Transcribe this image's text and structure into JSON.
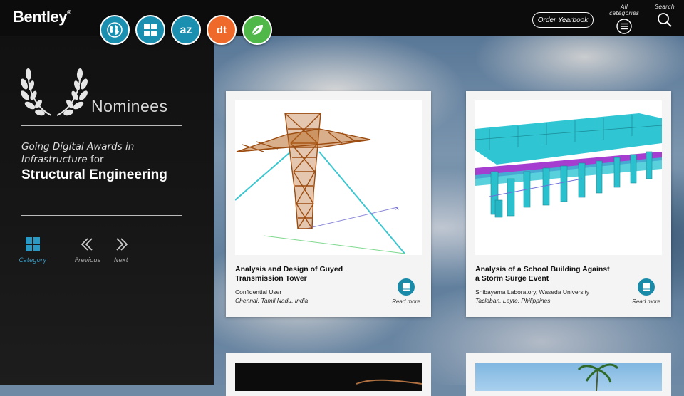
{
  "header": {
    "logo_text": "Bentley",
    "logo_mark": "®",
    "category_icons": [
      {
        "name": "globe-icon",
        "color": "#1b8fb0"
      },
      {
        "name": "grid-icon",
        "color": "#1b8fb0"
      },
      {
        "name": "az-icon",
        "text": "az",
        "color": "#1b8fb0"
      },
      {
        "name": "digital-twin-icon",
        "text": "dt",
        "color": "#ef6a2a"
      },
      {
        "name": "leaf-icon",
        "color": "#4fb848"
      }
    ],
    "order_yearbook_label": "Order Yearbook",
    "all_categories_label": "All categories",
    "search_label": "Search"
  },
  "sidebar": {
    "nominees_label": "Nominees",
    "award_line_1": "Going Digital Awards in",
    "award_line_2": "Infrastructure",
    "award_for": " for",
    "category_title": "Structural Engineering",
    "nav": {
      "category_label": "Category",
      "previous_label": "Previous",
      "next_label": "Next"
    }
  },
  "cards": [
    {
      "title": "Analysis and Design of Guyed Transmission Tower",
      "organization": "Confidential User",
      "location": "Chennai, Tamil Nadu, India",
      "read_more_label": "Read more"
    },
    {
      "title": "Analysis of a School Building Against a Storm Surge Event",
      "organization": "Shibayama Laboratory, Waseda University",
      "location": "Tacloban, Leyte, Philippines",
      "read_more_label": "Read more"
    }
  ],
  "colors": {
    "accent": "#1a8aa9",
    "topbar": "#0c0c0c"
  }
}
